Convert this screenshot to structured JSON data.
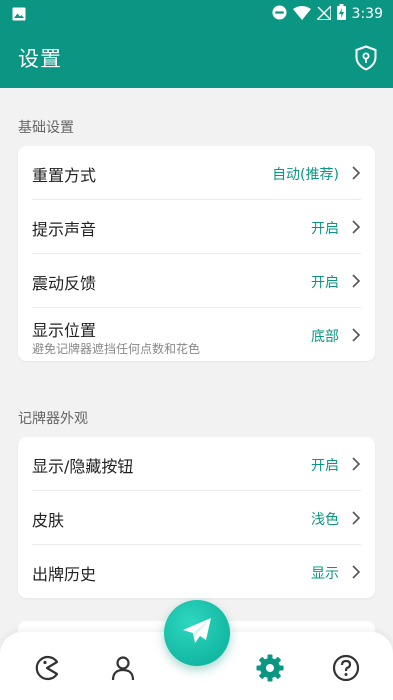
{
  "status_bar": {
    "time": "3:39",
    "icons": [
      "image-icon",
      "do-not-disturb-icon",
      "wifi-icon",
      "no-signal-icon",
      "battery-charging-icon"
    ]
  },
  "app_bar": {
    "title": "设置",
    "action_icon": "shield-lock-icon"
  },
  "colors": {
    "primary": "#0b9684",
    "accent": "#13b8a2",
    "background": "#f2f2f2"
  },
  "sections": [
    {
      "title": "基础设置",
      "rows": [
        {
          "label": "重置方式",
          "value": "自动(推荐)"
        },
        {
          "label": "提示声音",
          "value": "开启"
        },
        {
          "label": "震动反馈",
          "value": "开启"
        },
        {
          "label": "显示位置",
          "sub": "避免记牌器遮挡任何点数和花色",
          "value": "底部"
        }
      ]
    },
    {
      "title": "记牌器外观",
      "rows": [
        {
          "label": "显示/隐藏按钮",
          "value": "开启"
        },
        {
          "label": "皮肤",
          "value": "浅色"
        },
        {
          "label": "出牌历史",
          "value": "显示"
        }
      ]
    }
  ],
  "bottom_nav": {
    "items": [
      "pacman-icon",
      "profile-icon",
      "paper-plane-icon",
      "settings-gear-icon",
      "help-icon"
    ],
    "active": "settings-gear-icon"
  }
}
